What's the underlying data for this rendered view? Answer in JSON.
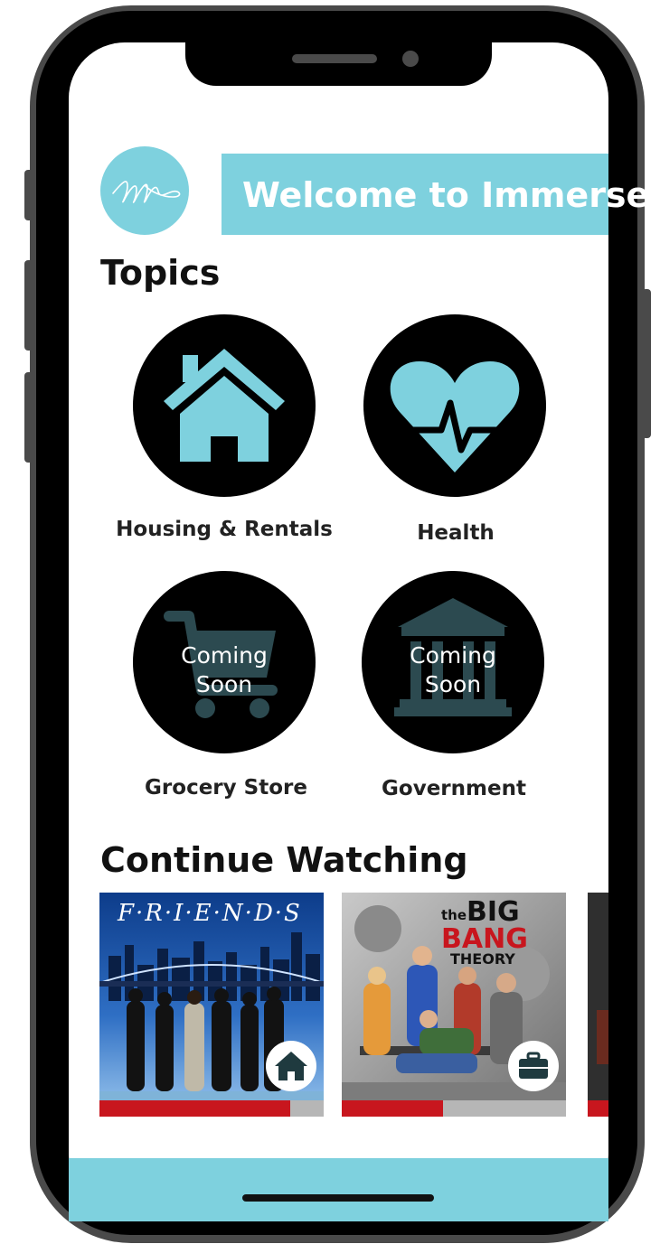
{
  "header": {
    "banner_text": "Welcome to Immerse",
    "logo_icon": "immerse-logo-icon"
  },
  "topics": {
    "heading": "Topics",
    "items": [
      {
        "label": "Housing & Rentals",
        "icon": "house-icon",
        "status": ""
      },
      {
        "label": "Health",
        "icon": "heart-pulse-icon",
        "status": ""
      },
      {
        "label": "Grocery Store",
        "icon": "shopping-cart-icon",
        "status_line1": "Coming",
        "status_line2": "Soon"
      },
      {
        "label": "Government",
        "icon": "government-building-icon",
        "status_line1": "Coming",
        "status_line2": "Soon"
      }
    ]
  },
  "continue_watching": {
    "heading": "Continue Watching",
    "items": [
      {
        "title": "F·R·I·E·N·D·S",
        "topic_icon": "house-icon",
        "progress": 0.85
      },
      {
        "title_small": "the",
        "title_big": "BIG",
        "title_mid": "BANG",
        "title_sub": "THEORY",
        "topic_icon": "briefcase-icon",
        "progress": 0.45
      },
      {
        "progress": 1.0
      }
    ]
  },
  "colors": {
    "accent": "#7ed1de",
    "progress": "#c8161e",
    "badge_icon": "#1f3a3f"
  }
}
